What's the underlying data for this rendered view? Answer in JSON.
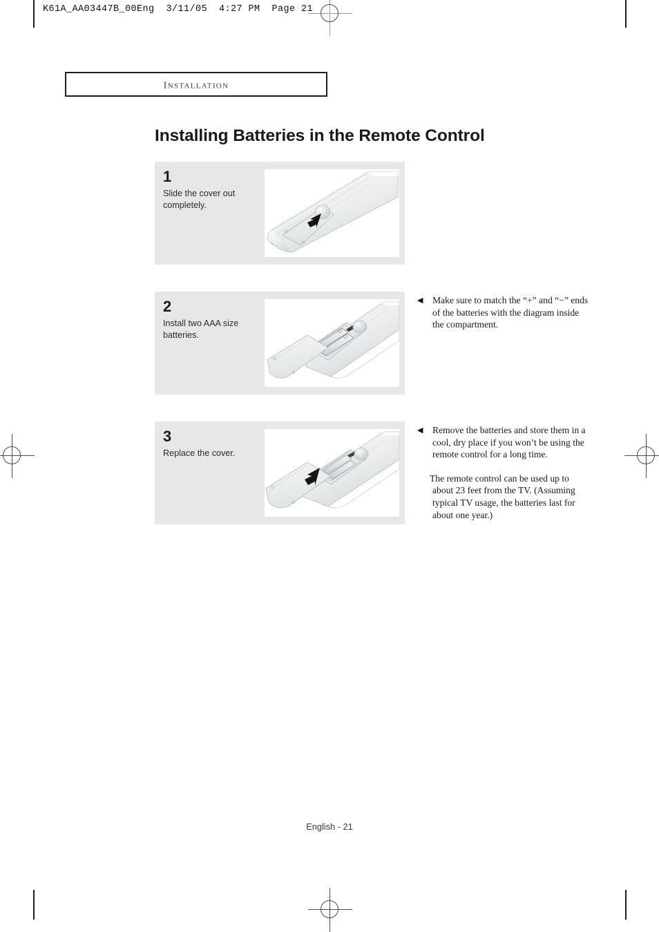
{
  "print_header": "K61A_AA03447B_00Eng  3/11/05  4:27 PM  Page 21",
  "chapter": {
    "label": "INSTALLATION"
  },
  "title": "Installing Batteries in the Remote Control",
  "steps": [
    {
      "number": "1",
      "description": "Slide the cover out completely.",
      "figure_name": "remote-cover-slide-illustration"
    },
    {
      "number": "2",
      "description": "Install two AAA size batteries.",
      "figure_name": "remote-batteries-install-illustration"
    },
    {
      "number": "3",
      "description": "Replace the cover.",
      "figure_name": "remote-cover-replace-illustration"
    }
  ],
  "notes": [
    {
      "bullet": "◀",
      "text": "Make sure to match the “+” and “−” ends of the batteries with the diagram inside the compartment."
    },
    {
      "bullet": "◀",
      "text": "Remove the batteries and store them in a cool, dry place if you won’t be using the remote control for a long time.",
      "extra": "The remote control can be used up to about 23 feet from the TV. (Assuming typical TV usage, the batteries last for about one year.)"
    }
  ],
  "footer": "English - 21",
  "colors": {
    "panel_background": "#e5e7e8",
    "text": "#1a1a1a",
    "chapter_text": "#3c3c46"
  }
}
